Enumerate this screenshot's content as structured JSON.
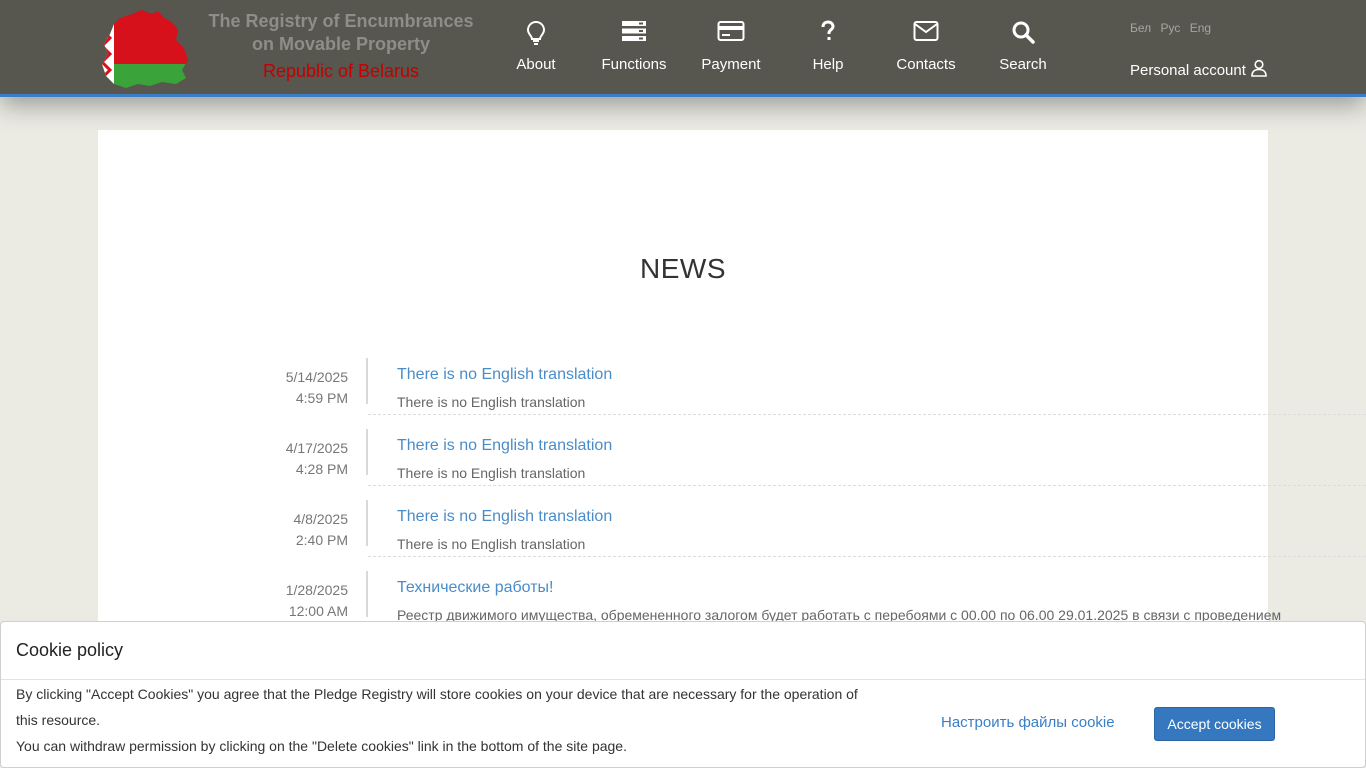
{
  "brand": {
    "title": "The Registry of Encumbrances on Movable Property",
    "subtitle": "Republic of Belarus",
    "logo_icon": "belarus-map-flag-icon"
  },
  "nav": [
    {
      "label": "About",
      "icon": "lightbulb-icon"
    },
    {
      "label": "Functions",
      "icon": "server-stack-icon"
    },
    {
      "label": "Payment",
      "icon": "credit-card-icon"
    },
    {
      "label": "Help",
      "icon": "question-icon"
    },
    {
      "label": "Contacts",
      "icon": "envelope-icon"
    },
    {
      "label": "Search",
      "icon": "search-icon"
    }
  ],
  "languages": [
    "Бел",
    "Рус",
    "Eng"
  ],
  "account": {
    "label": "Personal account",
    "icon": "user-icon"
  },
  "news": {
    "title": "NEWS",
    "items": [
      {
        "date": "5/14/2025",
        "time": "4:59 PM",
        "title": "There is no English translation",
        "text": "There is no English translation"
      },
      {
        "date": "4/17/2025",
        "time": "4:28 PM",
        "title": "There is no English translation",
        "text": "There is no English translation"
      },
      {
        "date": "4/8/2025",
        "time": "2:40 PM",
        "title": "There is no English translation",
        "text": "There is no English translation"
      },
      {
        "date": "1/28/2025",
        "time": "12:00 AM",
        "title": "Технические работы!",
        "text": "Реестр движимого имущества, обремененного залогом будет работать с перебоями с 00.00 по 06.00 29.01.2025 в связи с проведением"
      }
    ]
  },
  "cookie": {
    "title": "Cookie policy",
    "line1": "By clicking \"Accept Cookies\" you agree that the Pledge Registry will store cookies on your device that are necessary for the operation of",
    "line2": "this resource.",
    "line3": "You can withdraw permission by clicking on the \"Delete cookies\" link in the bottom of the site page.",
    "configure_label": "Настроить файлы cookie",
    "accept_label": "Accept cookies"
  },
  "colors": {
    "header_bg": "#57564f",
    "accent": "#3a7fc4",
    "link": "#4a8cc8",
    "brand_sub": "#c40000"
  }
}
